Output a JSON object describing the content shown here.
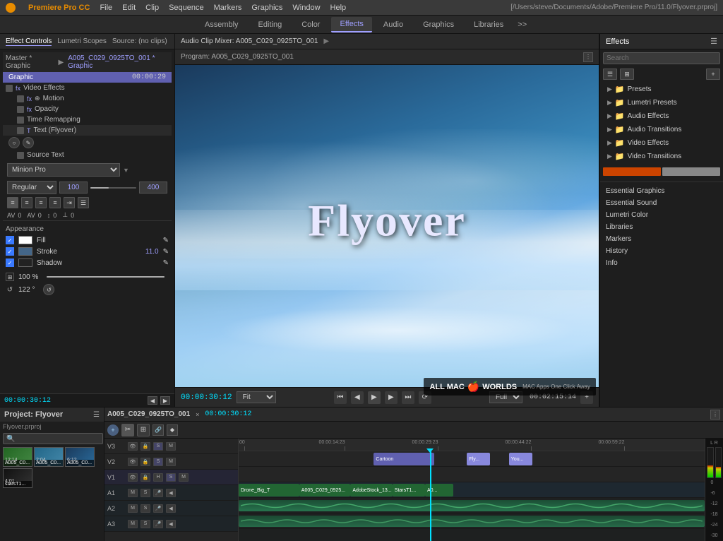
{
  "app": {
    "name": "Premiere Pro CC",
    "company": "Adobe",
    "path": "[/Users/steve/Documents/Adobe/Premiere Pro/11.0/Flyover.prproj]"
  },
  "menu": {
    "items": [
      "File",
      "Edit",
      "Clip",
      "Sequence",
      "Markers",
      "Graphics",
      "Window",
      "Help"
    ]
  },
  "tabs": {
    "items": [
      "Assembly",
      "Editing",
      "Color",
      "Effects",
      "Audio",
      "Graphics",
      "Libraries"
    ],
    "active": "Effects",
    "more": ">>"
  },
  "effect_controls": {
    "title": "Effect Controls",
    "lumetri": "Lumetri Scopes",
    "source": "Source: (no clips)",
    "master_label": "Master * Graphic",
    "clip_label": "A005_C029_0925TO_001 * Graphic",
    "graphic_header": "Graphic",
    "timecode": "00:00:29",
    "sections": {
      "video_effects": "Video Effects",
      "motion": "Motion",
      "opacity": "Opacity",
      "time_remapping": "Time Remapping",
      "text_flyover": "Text (Flyover)",
      "source_text": "Source Text"
    },
    "font": "Minion Pro",
    "style": "Regular",
    "size": "100",
    "tracking": "400",
    "appearance": {
      "title": "Appearance",
      "fill": "Fill",
      "stroke": "Stroke",
      "stroke_val": "11.0",
      "shadow": "Shadow"
    },
    "transform": {
      "scale": "100 %",
      "rotation": "122 °"
    }
  },
  "clip_mixer": {
    "label": "Audio Clip Mixer: A005_C029_0925TO_001",
    "arrow": "▶"
  },
  "program_monitor": {
    "label": "Program: A005_C029_0925TO_001",
    "timecode": "00:00:30:12",
    "fit_label": "Fit",
    "quality_label": "Full",
    "duration": "00:02:15:14",
    "flyover_text": "Flyover"
  },
  "effects_panel": {
    "title": "Effects",
    "search_placeholder": "Search",
    "categories": [
      {
        "label": "Presets",
        "icon": "folder"
      },
      {
        "label": "Lumetri Presets",
        "icon": "folder"
      },
      {
        "label": "Audio Effects",
        "icon": "folder"
      },
      {
        "label": "Audio Transitions",
        "icon": "folder"
      },
      {
        "label": "Video Effects",
        "icon": "folder"
      },
      {
        "label": "Video Transitions",
        "icon": "folder"
      }
    ],
    "named_items": [
      "Essential Graphics",
      "Essential Sound",
      "Lumetri Color",
      "Libraries",
      "Markers",
      "History",
      "Info"
    ]
  },
  "project_panel": {
    "title": "Project: Flyover",
    "file": "Flyover.prproj",
    "items": [
      {
        "name": "A005_C0...",
        "meta": "12:14"
      },
      {
        "name": "A005_C0...",
        "meta": "2:04"
      },
      {
        "name": "A005_C0...",
        "meta": "6:12"
      },
      {
        "name": "starsT1.mp4",
        "meta": "4:01"
      }
    ]
  },
  "timeline": {
    "sequence": "A005_C029_0925TO_001",
    "timecode": "00:00:30:12",
    "markers": [
      "00:00:14:23",
      "00:00:29:23",
      "00:00:44:22",
      "00:00:59:22"
    ],
    "tracks": {
      "video": [
        {
          "name": "V3",
          "clips": [
            {
              "label": "Cartoon",
              "color": "#6060b0",
              "left": "30%",
              "width": "12%"
            },
            {
              "label": "Fly...",
              "color": "#8888ff",
              "left": "50%",
              "width": "5%"
            },
            {
              "label": "You...",
              "color": "#8888ff",
              "left": "60%",
              "width": "5%"
            }
          ]
        },
        {
          "name": "V2",
          "clips": []
        },
        {
          "name": "V1",
          "clips": [
            {
              "label": "Drone_Big_T",
              "color": "#226622",
              "left": "0%",
              "width": "14%"
            },
            {
              "label": "A005_C029_0925...",
              "color": "#226622",
              "left": "14%",
              "width": "12%"
            },
            {
              "label": "AdobeStock_13...",
              "color": "#226622",
              "left": "26%",
              "width": "10%"
            },
            {
              "label": "StarsTI...",
              "color": "#226622",
              "left": "36%",
              "width": "8%"
            },
            {
              "label": "A0...",
              "color": "#226622",
              "left": "44%",
              "width": "6%"
            }
          ]
        }
      ],
      "audio": [
        {
          "name": "A1",
          "type": "audio",
          "color": "#1a4a4a"
        },
        {
          "name": "A2",
          "type": "audio",
          "color": "#1a4a4a"
        },
        {
          "name": "A3",
          "type": "audio",
          "color": "#1a4a4a"
        }
      ]
    }
  },
  "watermark": {
    "text": "ALL MAC",
    "suffix": "WORLDS",
    "tagline": "MAC Apps One Click Away"
  }
}
